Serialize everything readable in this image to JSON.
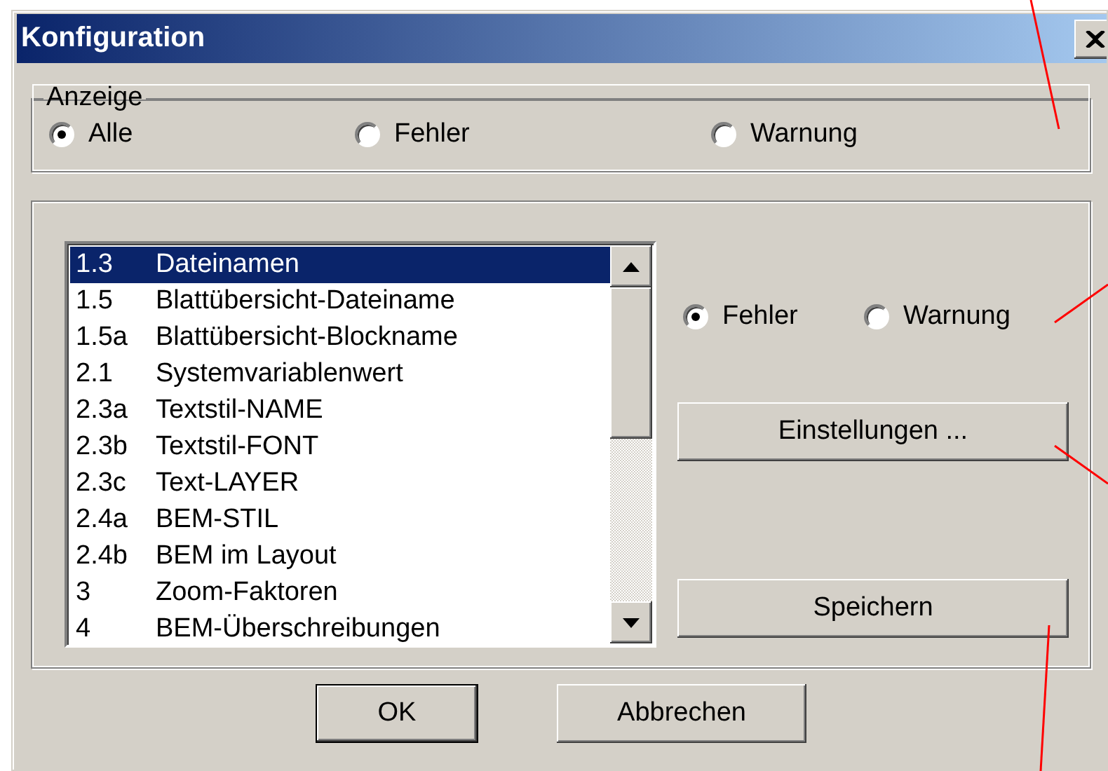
{
  "window": {
    "title": "Konfiguration"
  },
  "display_group": {
    "label": "Anzeige",
    "options": [
      {
        "label": "Alle",
        "selected": true
      },
      {
        "label": "Fehler",
        "selected": false
      },
      {
        "label": "Warnung",
        "selected": false
      }
    ]
  },
  "checks_group": {
    "list": {
      "items": [
        {
          "code": "1.3",
          "name": "Dateinamen",
          "selected": true
        },
        {
          "code": "1.5",
          "name": "Blattübersicht-Dateiname",
          "selected": false
        },
        {
          "code": "1.5a",
          "name": "Blattübersicht-Blockname",
          "selected": false
        },
        {
          "code": "2.1",
          "name": "Systemvariablenwert",
          "selected": false
        },
        {
          "code": "2.3a",
          "name": "Textstil-NAME",
          "selected": false
        },
        {
          "code": "2.3b",
          "name": "Textstil-FONT",
          "selected": false
        },
        {
          "code": "2.3c",
          "name": "Text-LAYER",
          "selected": false
        },
        {
          "code": "2.4a",
          "name": "BEM-STIL",
          "selected": false
        },
        {
          "code": "2.4b",
          "name": "BEM im Layout",
          "selected": false
        },
        {
          "code": "3",
          "name": "Zoom-Faktoren",
          "selected": false
        },
        {
          "code": "4",
          "name": "BEM-Überschreibungen",
          "selected": false
        }
      ]
    },
    "severity": [
      {
        "label": "Fehler",
        "selected": true
      },
      {
        "label": "Warnung",
        "selected": false
      }
    ],
    "buttons": [
      {
        "label": "Einstellungen ..."
      },
      {
        "label": "Speichern"
      }
    ]
  },
  "buttons": [
    {
      "label": "OK",
      "default": true
    },
    {
      "label": "Abbrechen",
      "default": false
    }
  ]
}
